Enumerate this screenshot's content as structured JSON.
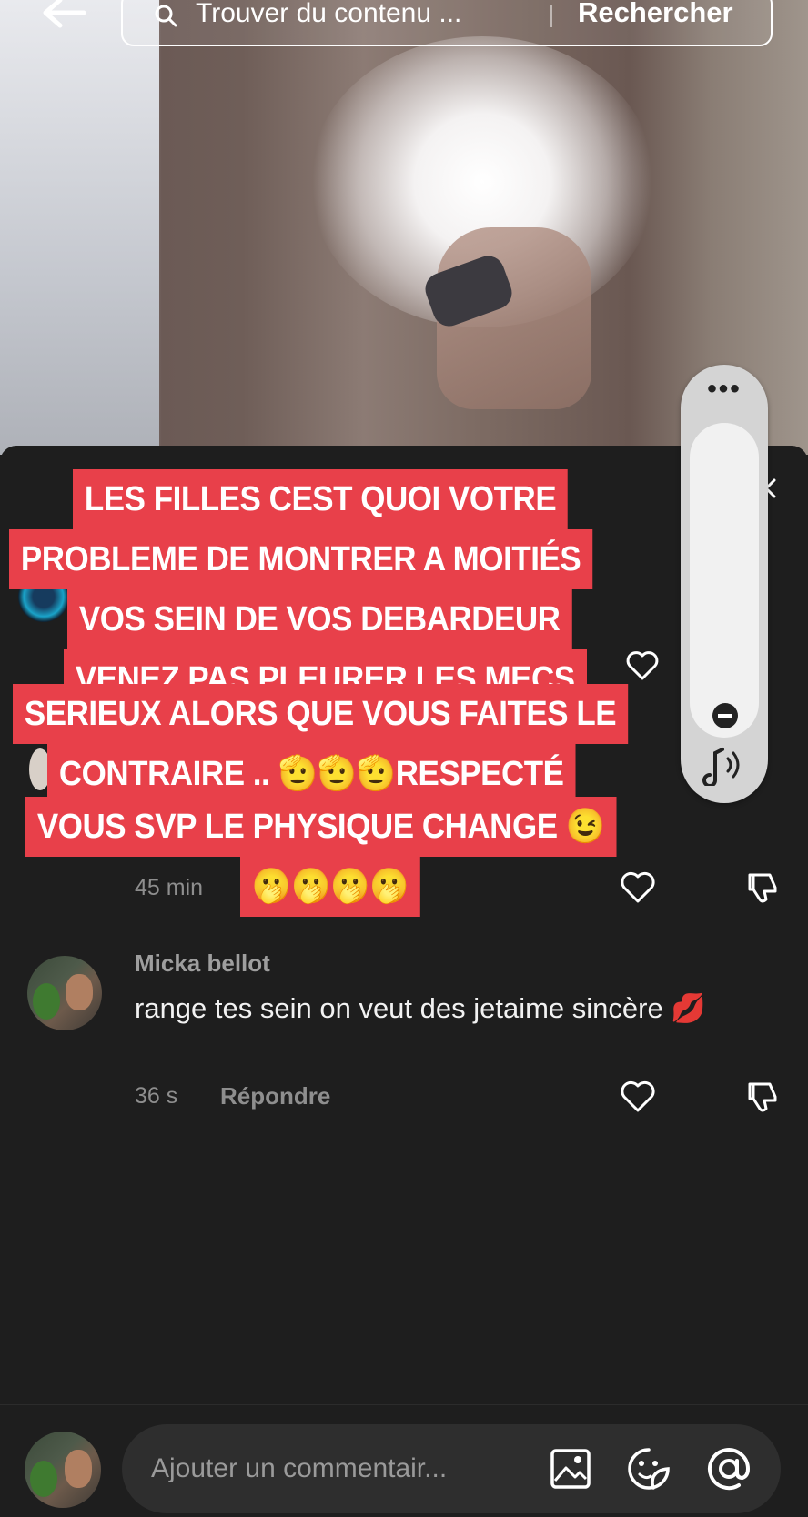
{
  "search": {
    "placeholder": "Trouver du contenu ...",
    "submit_label": "Rechercher"
  },
  "overlay": {
    "lines": [
      "LES FILLES CEST QUOI VOTRE",
      "PROBLEME DE MONTRER A MOITIÉS",
      "VOS SEIN DE VOS DEBARDEUR",
      "VENEZ PAS PLEURER LES MECS",
      "SERIEUX ALORS QUE VOUS FAITES LE",
      "CONTRAIRE ..   🫡🫡🫡RESPECTÉ",
      "VOUS SVP LE PHYSIQUE CHANGE 😉",
      "🫢🫢🫢🫢"
    ],
    "color": "#e8404a"
  },
  "comments": {
    "first": {
      "time": "45 min"
    },
    "second": {
      "author": "Micka bellot",
      "text": "range tes sein on veut des jetaime sincère 💋",
      "time": "36 s",
      "reply_label": "Répondre"
    }
  },
  "composer": {
    "placeholder": "Ajouter un commentair..."
  },
  "volume": {
    "menu_dots": "•••"
  }
}
